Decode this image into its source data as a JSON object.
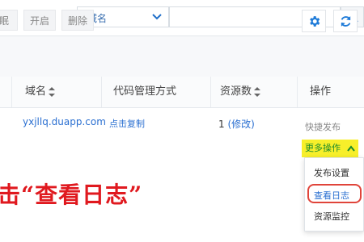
{
  "search": {
    "scope_value": "域名",
    "query_value": "",
    "query_placeholder": ""
  },
  "toolbar": {
    "sleep_label": "眠",
    "start_label": "开启",
    "delete_label": "删除"
  },
  "table": {
    "columns": [
      "域名",
      "代码管理方式",
      "资源数",
      "操作"
    ],
    "rows": [
      {
        "domain": "yxjllq.duapp.com",
        "code_mgmt": "点击复制",
        "resources": "1",
        "resources_edit": "(修改)",
        "quick_publish": "快捷发布",
        "more_ops": "更多操作"
      }
    ]
  },
  "dropdown": {
    "items": [
      "发布设置",
      "查看日志",
      "资源监控"
    ]
  },
  "annotation": {
    "text": "击“查看日志”"
  },
  "colors": {
    "link": "#2a6fd1",
    "highlight": "#f7ef2a",
    "more_ops_text": "#1a8a2c",
    "annotation": "#e0191f",
    "toolbar_icon": "#1f7bd8"
  }
}
